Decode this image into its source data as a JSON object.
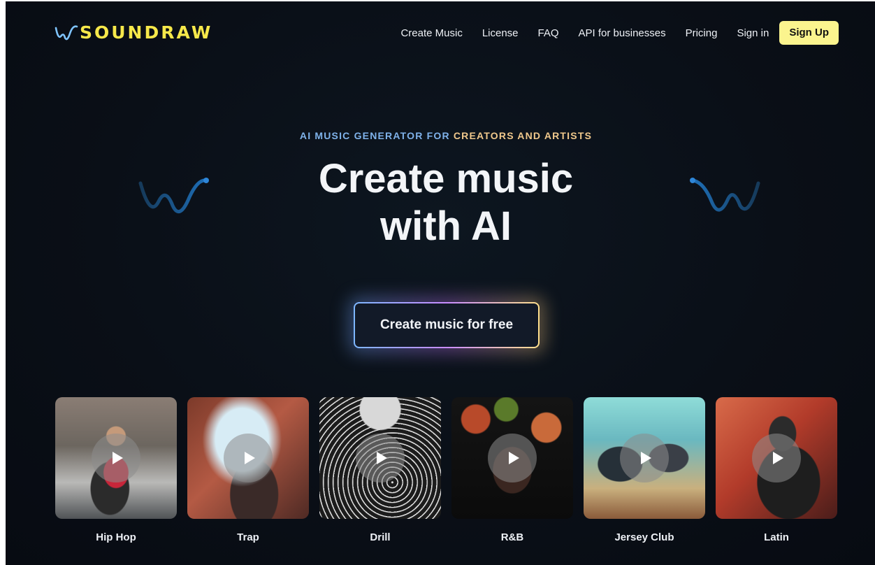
{
  "brand": {
    "name": "SOUNDRAW",
    "logo_icon": "wave-logo-icon",
    "logo_color": "#f6e84a"
  },
  "nav": {
    "links": [
      "Create Music",
      "License",
      "FAQ",
      "API for businesses",
      "Pricing",
      "Sign in"
    ],
    "signup_label": "Sign Up"
  },
  "hero": {
    "eyebrow_part1": "AI MUSIC GENERATOR FOR ",
    "eyebrow_part2": "CREATORS AND ARTISTS",
    "headline_line1": "Create music",
    "headline_line2": "with AI",
    "cta_label": "Create music for free"
  },
  "genres": [
    {
      "label": "Hip Hop"
    },
    {
      "label": "Trap"
    },
    {
      "label": "Drill"
    },
    {
      "label": "R&B"
    },
    {
      "label": "Jersey Club"
    },
    {
      "label": "Latin"
    }
  ],
  "colors": {
    "background": "#0a0f17",
    "accent_yellow": "#fbf48e",
    "eyebrow_blue": "#7fb2ea",
    "eyebrow_gold": "#f0c88c"
  }
}
